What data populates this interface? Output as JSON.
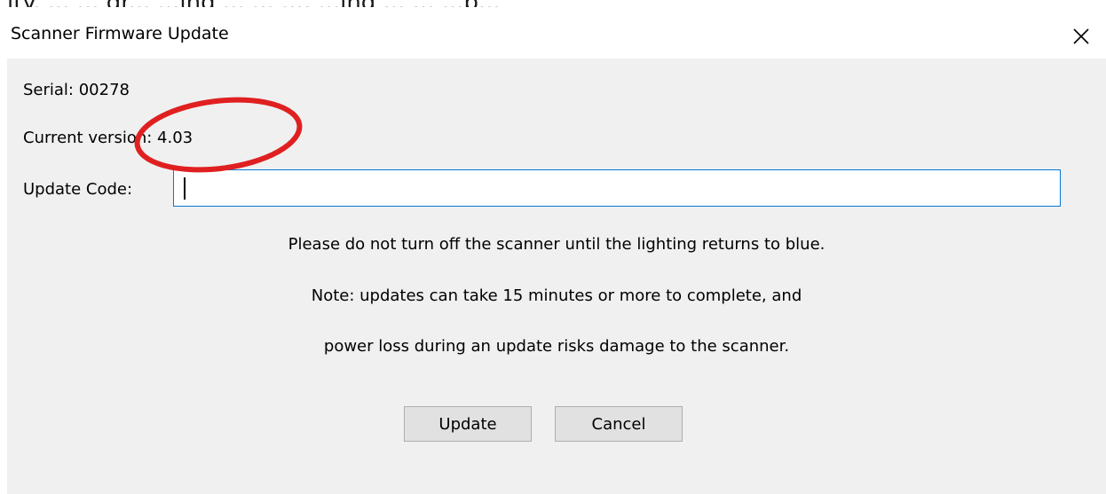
{
  "background_text": "ity.  ...  ...  dr... ...ing ...  ...  ..., ...ing ...  ...  ...p...",
  "dialog": {
    "title": "Scanner Firmware Update",
    "close_icon": "close-icon"
  },
  "info": {
    "serial": "Serial: 00278",
    "current_version": "Current version: 4.03",
    "update_code_label": "Update Code:"
  },
  "update_code_input": {
    "value": "",
    "placeholder": ""
  },
  "messages": [
    "Please do not turn off the scanner until the lighting returns to blue.",
    "Note: updates can take 15 minutes or more to complete, and",
    "power loss during an update risks damage to the scanner."
  ],
  "buttons": {
    "update": "Update",
    "cancel": "Cancel"
  },
  "colors": {
    "client_background": "#f0f0f0",
    "input_focus_border": "#0078d7",
    "button_face": "#e1e1e1",
    "annotation_circle": "#e02020"
  }
}
